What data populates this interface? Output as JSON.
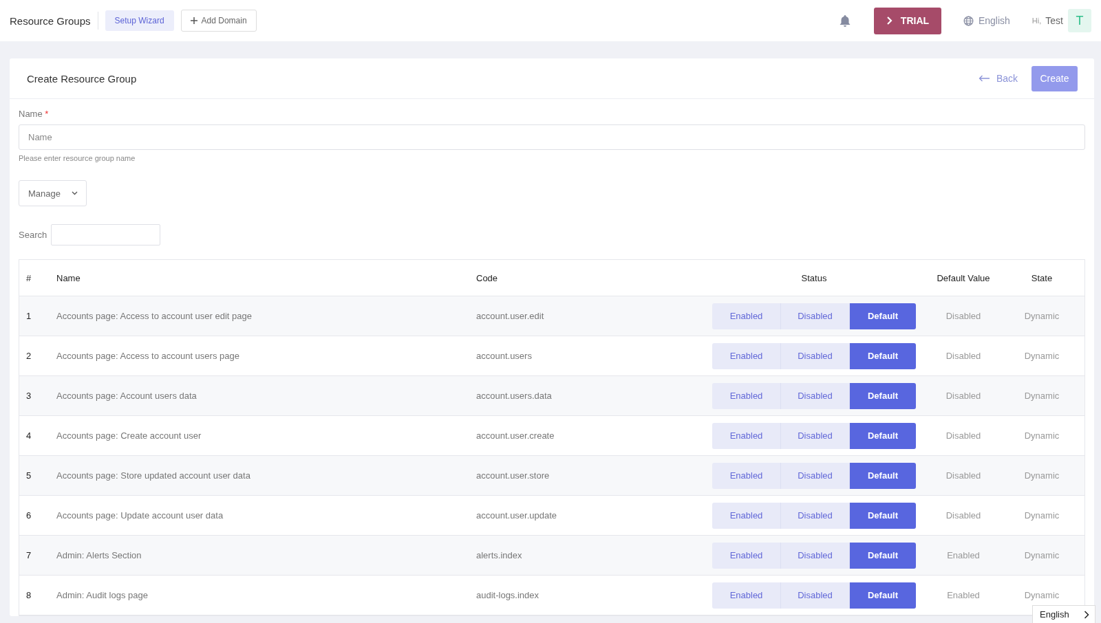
{
  "topbar": {
    "title": "Resource Groups",
    "setup_button": "Setup Wizard",
    "add_domain_button": "Add Domain",
    "trial_button": "TRIAL",
    "language": "English",
    "greeting": "Hi,",
    "user_name": "Test",
    "avatar_letter": "T"
  },
  "card": {
    "title": "Create Resource Group",
    "back_link": "Back",
    "create_button": "Create"
  },
  "name_field": {
    "label": "Name",
    "required_mark": "*",
    "placeholder": "Name",
    "help": "Please enter resource group name"
  },
  "manage_dropdown": {
    "value": "Manage"
  },
  "search": {
    "label": "Search"
  },
  "table": {
    "columns": [
      "#",
      "Name",
      "Code",
      "Status",
      "Default Value",
      "State"
    ],
    "rows": [
      {
        "index": "1",
        "name": "Accounts page: Access to account user edit page",
        "code": "account.user.edit",
        "status": [
          {
            "label": "Enabled",
            "selected": false
          },
          {
            "label": "Disabled",
            "selected": false
          },
          {
            "label": "Default",
            "selected": true
          }
        ],
        "default_value": "Disabled",
        "state": "Dynamic"
      },
      {
        "index": "2",
        "name": "Accounts page: Access to account users page",
        "code": "account.users",
        "status": [
          {
            "label": "Enabled",
            "selected": false
          },
          {
            "label": "Disabled",
            "selected": false
          },
          {
            "label": "Default",
            "selected": true
          }
        ],
        "default_value": "Disabled",
        "state": "Dynamic"
      },
      {
        "index": "3",
        "name": "Accounts page: Account users data",
        "code": "account.users.data",
        "status": [
          {
            "label": "Enabled",
            "selected": false
          },
          {
            "label": "Disabled",
            "selected": false
          },
          {
            "label": "Default",
            "selected": true
          }
        ],
        "default_value": "Disabled",
        "state": "Dynamic"
      },
      {
        "index": "4",
        "name": "Accounts page: Create account user",
        "code": "account.user.create",
        "status": [
          {
            "label": "Enabled",
            "selected": false
          },
          {
            "label": "Disabled",
            "selected": false
          },
          {
            "label": "Default",
            "selected": true
          }
        ],
        "default_value": "Disabled",
        "state": "Dynamic"
      },
      {
        "index": "5",
        "name": "Accounts page: Store updated account user data",
        "code": "account.user.store",
        "status": [
          {
            "label": "Enabled",
            "selected": false
          },
          {
            "label": "Disabled",
            "selected": false
          },
          {
            "label": "Default",
            "selected": true
          }
        ],
        "default_value": "Disabled",
        "state": "Dynamic"
      },
      {
        "index": "6",
        "name": "Accounts page: Update account user data",
        "code": "account.user.update",
        "status": [
          {
            "label": "Enabled",
            "selected": false
          },
          {
            "label": "Disabled",
            "selected": false
          },
          {
            "label": "Default",
            "selected": true
          }
        ],
        "default_value": "Disabled",
        "state": "Dynamic"
      },
      {
        "index": "7",
        "name": "Admin: Alerts Section",
        "code": "alerts.index",
        "status": [
          {
            "label": "Enabled",
            "selected": false
          },
          {
            "label": "Disabled",
            "selected": false
          },
          {
            "label": "Default",
            "selected": true
          }
        ],
        "default_value": "Enabled",
        "state": "Dynamic"
      },
      {
        "index": "8",
        "name": "Admin: Audit logs page",
        "code": "audit-logs.index",
        "status": [
          {
            "label": "Enabled",
            "selected": false
          },
          {
            "label": "Disabled",
            "selected": false
          },
          {
            "label": "Default",
            "selected": true
          }
        ],
        "default_value": "Enabled",
        "state": "Dynamic"
      }
    ]
  },
  "language_popup": {
    "label": "English"
  }
}
